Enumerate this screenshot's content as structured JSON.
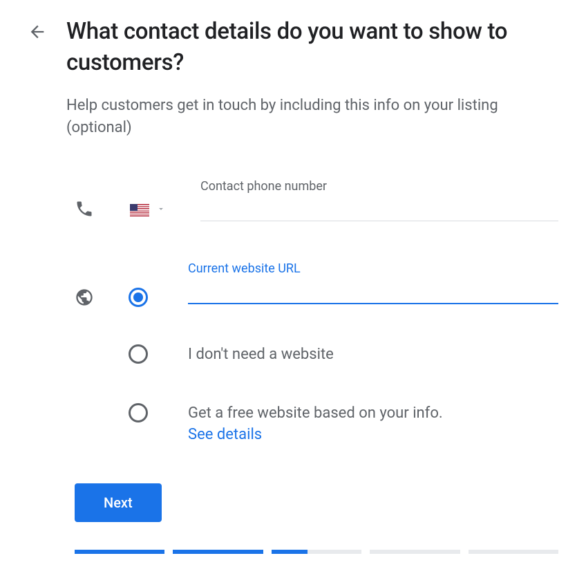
{
  "header": {
    "title": "What contact details do you want to show to customers?",
    "subtitle": "Help customers get in touch by including this info on your listing (optional)"
  },
  "phone": {
    "label": "Contact phone number",
    "value": "",
    "country_code": "US"
  },
  "website": {
    "url_label": "Current website URL",
    "url_value": "",
    "options": [
      {
        "label": "",
        "type": "url_input",
        "selected": true
      },
      {
        "label": "I don't need a website",
        "selected": false
      },
      {
        "label": "Get a free website based on your info.",
        "link": "See details",
        "selected": false
      }
    ]
  },
  "actions": {
    "next": "Next"
  },
  "progress": {
    "total": 5,
    "completed": 2,
    "current_partial": 0.4
  },
  "colors": {
    "primary": "#1a73e8",
    "text_primary": "#202124",
    "text_secondary": "#5f6368"
  }
}
